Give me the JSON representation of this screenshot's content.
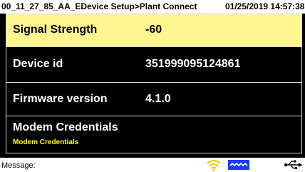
{
  "titlebar": {
    "path": "00_11_27_85_AA_EDevice Setup>Plant Connect",
    "datetime": "01/25/2019 14:57:38"
  },
  "rows": [
    {
      "label": "Signal Strength",
      "value": "-60",
      "selected": true
    },
    {
      "label": "Device id",
      "value": "351999095124861"
    },
    {
      "label": "Firmware version",
      "value": "4.1.0"
    },
    {
      "label": "Modem Credentials",
      "sublabel": "Modem Credentials"
    }
  ],
  "statusbar": {
    "message_label": "Message:"
  },
  "icons": [
    "wifi-icon",
    "modem-icon",
    "usb-icon"
  ],
  "colors": {
    "selected_row": "#fff68f",
    "sublabel": "#ffff00",
    "wifi": "#f0d000",
    "modem": "#1a3cff"
  }
}
